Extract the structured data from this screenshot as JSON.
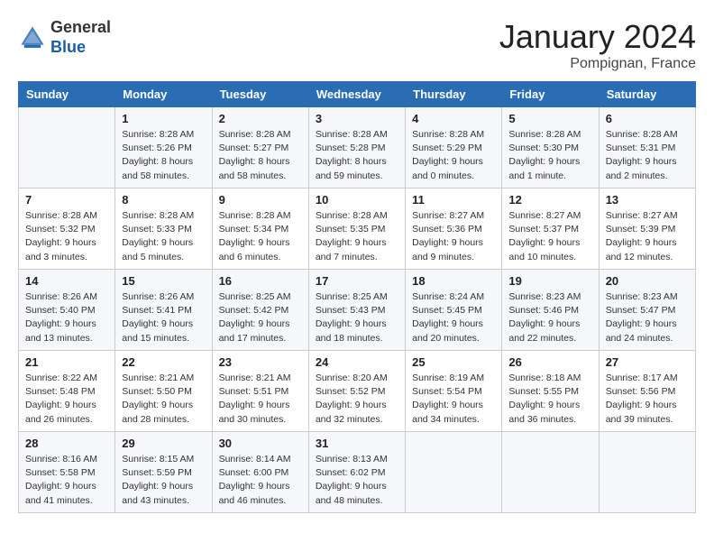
{
  "logo": {
    "general": "General",
    "blue": "Blue"
  },
  "header": {
    "month": "January 2024",
    "location": "Pompignan, France"
  },
  "days": [
    "Sunday",
    "Monday",
    "Tuesday",
    "Wednesday",
    "Thursday",
    "Friday",
    "Saturday"
  ],
  "weeks": [
    [
      {
        "date": "",
        "sunrise": "",
        "sunset": "",
        "daylight": ""
      },
      {
        "date": "1",
        "sunrise": "Sunrise: 8:28 AM",
        "sunset": "Sunset: 5:26 PM",
        "daylight": "Daylight: 8 hours and 58 minutes."
      },
      {
        "date": "2",
        "sunrise": "Sunrise: 8:28 AM",
        "sunset": "Sunset: 5:27 PM",
        "daylight": "Daylight: 8 hours and 58 minutes."
      },
      {
        "date": "3",
        "sunrise": "Sunrise: 8:28 AM",
        "sunset": "Sunset: 5:28 PM",
        "daylight": "Daylight: 8 hours and 59 minutes."
      },
      {
        "date": "4",
        "sunrise": "Sunrise: 8:28 AM",
        "sunset": "Sunset: 5:29 PM",
        "daylight": "Daylight: 9 hours and 0 minutes."
      },
      {
        "date": "5",
        "sunrise": "Sunrise: 8:28 AM",
        "sunset": "Sunset: 5:30 PM",
        "daylight": "Daylight: 9 hours and 1 minute."
      },
      {
        "date": "6",
        "sunrise": "Sunrise: 8:28 AM",
        "sunset": "Sunset: 5:31 PM",
        "daylight": "Daylight: 9 hours and 2 minutes."
      }
    ],
    [
      {
        "date": "7",
        "sunrise": "Sunrise: 8:28 AM",
        "sunset": "Sunset: 5:32 PM",
        "daylight": "Daylight: 9 hours and 3 minutes."
      },
      {
        "date": "8",
        "sunrise": "Sunrise: 8:28 AM",
        "sunset": "Sunset: 5:33 PM",
        "daylight": "Daylight: 9 hours and 5 minutes."
      },
      {
        "date": "9",
        "sunrise": "Sunrise: 8:28 AM",
        "sunset": "Sunset: 5:34 PM",
        "daylight": "Daylight: 9 hours and 6 minutes."
      },
      {
        "date": "10",
        "sunrise": "Sunrise: 8:28 AM",
        "sunset": "Sunset: 5:35 PM",
        "daylight": "Daylight: 9 hours and 7 minutes."
      },
      {
        "date": "11",
        "sunrise": "Sunrise: 8:27 AM",
        "sunset": "Sunset: 5:36 PM",
        "daylight": "Daylight: 9 hours and 9 minutes."
      },
      {
        "date": "12",
        "sunrise": "Sunrise: 8:27 AM",
        "sunset": "Sunset: 5:37 PM",
        "daylight": "Daylight: 9 hours and 10 minutes."
      },
      {
        "date": "13",
        "sunrise": "Sunrise: 8:27 AM",
        "sunset": "Sunset: 5:39 PM",
        "daylight": "Daylight: 9 hours and 12 minutes."
      }
    ],
    [
      {
        "date": "14",
        "sunrise": "Sunrise: 8:26 AM",
        "sunset": "Sunset: 5:40 PM",
        "daylight": "Daylight: 9 hours and 13 minutes."
      },
      {
        "date": "15",
        "sunrise": "Sunrise: 8:26 AM",
        "sunset": "Sunset: 5:41 PM",
        "daylight": "Daylight: 9 hours and 15 minutes."
      },
      {
        "date": "16",
        "sunrise": "Sunrise: 8:25 AM",
        "sunset": "Sunset: 5:42 PM",
        "daylight": "Daylight: 9 hours and 17 minutes."
      },
      {
        "date": "17",
        "sunrise": "Sunrise: 8:25 AM",
        "sunset": "Sunset: 5:43 PM",
        "daylight": "Daylight: 9 hours and 18 minutes."
      },
      {
        "date": "18",
        "sunrise": "Sunrise: 8:24 AM",
        "sunset": "Sunset: 5:45 PM",
        "daylight": "Daylight: 9 hours and 20 minutes."
      },
      {
        "date": "19",
        "sunrise": "Sunrise: 8:23 AM",
        "sunset": "Sunset: 5:46 PM",
        "daylight": "Daylight: 9 hours and 22 minutes."
      },
      {
        "date": "20",
        "sunrise": "Sunrise: 8:23 AM",
        "sunset": "Sunset: 5:47 PM",
        "daylight": "Daylight: 9 hours and 24 minutes."
      }
    ],
    [
      {
        "date": "21",
        "sunrise": "Sunrise: 8:22 AM",
        "sunset": "Sunset: 5:48 PM",
        "daylight": "Daylight: 9 hours and 26 minutes."
      },
      {
        "date": "22",
        "sunrise": "Sunrise: 8:21 AM",
        "sunset": "Sunset: 5:50 PM",
        "daylight": "Daylight: 9 hours and 28 minutes."
      },
      {
        "date": "23",
        "sunrise": "Sunrise: 8:21 AM",
        "sunset": "Sunset: 5:51 PM",
        "daylight": "Daylight: 9 hours and 30 minutes."
      },
      {
        "date": "24",
        "sunrise": "Sunrise: 8:20 AM",
        "sunset": "Sunset: 5:52 PM",
        "daylight": "Daylight: 9 hours and 32 minutes."
      },
      {
        "date": "25",
        "sunrise": "Sunrise: 8:19 AM",
        "sunset": "Sunset: 5:54 PM",
        "daylight": "Daylight: 9 hours and 34 minutes."
      },
      {
        "date": "26",
        "sunrise": "Sunrise: 8:18 AM",
        "sunset": "Sunset: 5:55 PM",
        "daylight": "Daylight: 9 hours and 36 minutes."
      },
      {
        "date": "27",
        "sunrise": "Sunrise: 8:17 AM",
        "sunset": "Sunset: 5:56 PM",
        "daylight": "Daylight: 9 hours and 39 minutes."
      }
    ],
    [
      {
        "date": "28",
        "sunrise": "Sunrise: 8:16 AM",
        "sunset": "Sunset: 5:58 PM",
        "daylight": "Daylight: 9 hours and 41 minutes."
      },
      {
        "date": "29",
        "sunrise": "Sunrise: 8:15 AM",
        "sunset": "Sunset: 5:59 PM",
        "daylight": "Daylight: 9 hours and 43 minutes."
      },
      {
        "date": "30",
        "sunrise": "Sunrise: 8:14 AM",
        "sunset": "Sunset: 6:00 PM",
        "daylight": "Daylight: 9 hours and 46 minutes."
      },
      {
        "date": "31",
        "sunrise": "Sunrise: 8:13 AM",
        "sunset": "Sunset: 6:02 PM",
        "daylight": "Daylight: 9 hours and 48 minutes."
      },
      {
        "date": "",
        "sunrise": "",
        "sunset": "",
        "daylight": ""
      },
      {
        "date": "",
        "sunrise": "",
        "sunset": "",
        "daylight": ""
      },
      {
        "date": "",
        "sunrise": "",
        "sunset": "",
        "daylight": ""
      }
    ]
  ]
}
